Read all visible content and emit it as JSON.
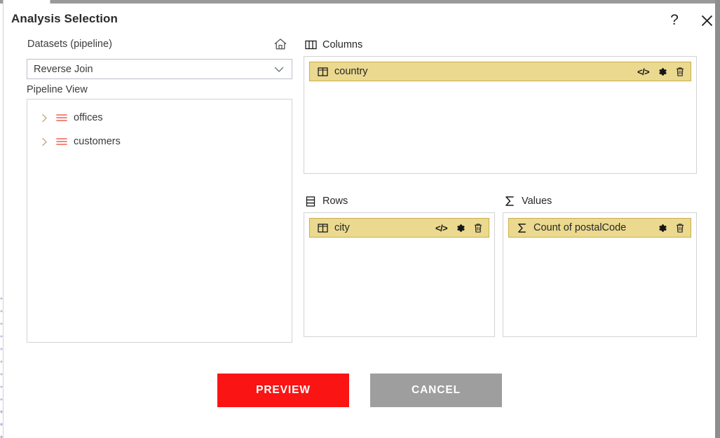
{
  "window": {
    "title": "Analysis Selection",
    "help_icon": "question-mark-icon",
    "close_icon": "close-icon"
  },
  "left_panel": {
    "datasets_label": "Datasets (pipeline)",
    "home_icon": "home-icon",
    "dataset_select": {
      "value": "Reverse Join",
      "chevron_icon": "chevron-down-icon"
    },
    "pipeline_view_label": "Pipeline View",
    "tree_items": [
      {
        "label": "offices",
        "chevron_icon": "chevron-right-icon",
        "type_icon": "table-lines-icon",
        "expanded": false
      },
      {
        "label": "customers",
        "chevron_icon": "chevron-right-icon",
        "type_icon": "table-lines-icon",
        "expanded": false
      }
    ]
  },
  "zones": {
    "columns": {
      "label": "Columns",
      "header_icon": "columns-grid-icon",
      "chips": [
        {
          "label": "country",
          "lead_icon": "column-field-icon",
          "actions": [
            {
              "name": "code-icon",
              "glyph": "</>"
            },
            {
              "name": "gear-icon",
              "glyph": "gear"
            },
            {
              "name": "trash-icon",
              "glyph": "trash"
            }
          ]
        }
      ]
    },
    "rows": {
      "label": "Rows",
      "header_icon": "rows-grid-icon",
      "chips": [
        {
          "label": "city",
          "lead_icon": "column-field-icon",
          "actions": [
            {
              "name": "code-icon",
              "glyph": "</>"
            },
            {
              "name": "gear-icon",
              "glyph": "gear"
            },
            {
              "name": "trash-icon",
              "glyph": "trash"
            }
          ]
        }
      ]
    },
    "values": {
      "label": "Values",
      "header_icon": "sigma-icon",
      "chips": [
        {
          "label": "Count of postalCode",
          "lead_icon": "sigma-icon",
          "actions": [
            {
              "name": "gear-icon",
              "glyph": "gear"
            },
            {
              "name": "trash-icon",
              "glyph": "trash"
            }
          ]
        }
      ]
    }
  },
  "footer": {
    "preview_label": "PREVIEW",
    "cancel_label": "CANCEL"
  },
  "colors": {
    "chip_fill": "#ebd98f",
    "chip_border": "#c9ad4c",
    "preview_button": "#fa1414",
    "cancel_button": "#9e9e9e",
    "dot_pattern": "#aab4e2",
    "tree_icon": "#f2776a"
  }
}
